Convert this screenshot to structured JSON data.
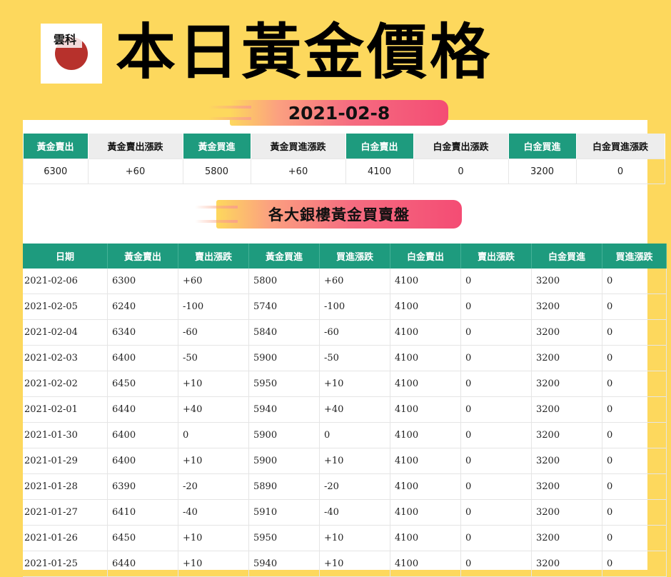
{
  "header": {
    "logo_text": "雲科",
    "title": "本日黃金價格",
    "date": "2021-02-8"
  },
  "summary": {
    "headers": [
      "黃金賣出",
      "黃金賣出漲跌",
      "黃金買進",
      "黃金買進漲跌",
      "白金賣出",
      "白金賣出漲跌",
      "白金買進",
      "白金買進漲跌"
    ],
    "values": [
      "6300",
      "+60",
      "5800",
      "+60",
      "4100",
      "0",
      "3200",
      "0"
    ]
  },
  "section_title": "各大銀樓黃金買賣盤",
  "history": {
    "headers": [
      "日期",
      "黃金賣出",
      "賣出漲跌",
      "黃金買進",
      "買進漲跌",
      "白金賣出",
      "賣出漲跌",
      "白金買進",
      "買進漲跌"
    ],
    "rows": [
      [
        "2021-02-06",
        "6300",
        "+60",
        "5800",
        "+60",
        "4100",
        "0",
        "3200",
        "0"
      ],
      [
        "2021-02-05",
        "6240",
        "-100",
        "5740",
        "-100",
        "4100",
        "0",
        "3200",
        "0"
      ],
      [
        "2021-02-04",
        "6340",
        "-60",
        "5840",
        "-60",
        "4100",
        "0",
        "3200",
        "0"
      ],
      [
        "2021-02-03",
        "6400",
        "-50",
        "5900",
        "-50",
        "4100",
        "0",
        "3200",
        "0"
      ],
      [
        "2021-02-02",
        "6450",
        "+10",
        "5950",
        "+10",
        "4100",
        "0",
        "3200",
        "0"
      ],
      [
        "2021-02-01",
        "6440",
        "+40",
        "5940",
        "+40",
        "4100",
        "0",
        "3200",
        "0"
      ],
      [
        "2021-01-30",
        "6400",
        "0",
        "5900",
        "0",
        "4100",
        "0",
        "3200",
        "0"
      ],
      [
        "2021-01-29",
        "6400",
        "+10",
        "5900",
        "+10",
        "4100",
        "0",
        "3200",
        "0"
      ],
      [
        "2021-01-28",
        "6390",
        "-20",
        "5890",
        "-20",
        "4100",
        "0",
        "3200",
        "0"
      ],
      [
        "2021-01-27",
        "6410",
        "-40",
        "5910",
        "-40",
        "4100",
        "0",
        "3200",
        "0"
      ],
      [
        "2021-01-26",
        "6450",
        "+10",
        "5950",
        "+10",
        "4100",
        "0",
        "3200",
        "0"
      ],
      [
        "2021-01-25",
        "6440",
        "+10",
        "5940",
        "+10",
        "4100",
        "0",
        "3200",
        "0"
      ]
    ]
  }
}
